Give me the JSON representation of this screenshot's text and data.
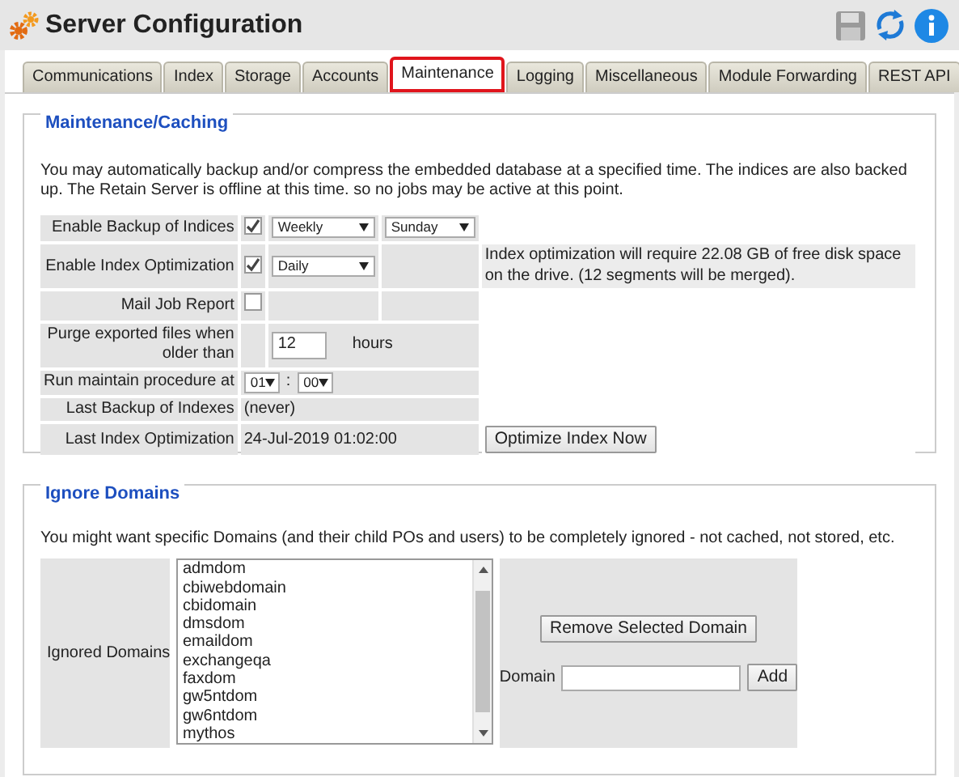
{
  "header": {
    "title": "Server Configuration"
  },
  "tabs": [
    {
      "label": "Communications",
      "selected": false
    },
    {
      "label": "Index",
      "selected": false
    },
    {
      "label": "Storage",
      "selected": false
    },
    {
      "label": "Accounts",
      "selected": false
    },
    {
      "label": "Maintenance",
      "selected": true
    },
    {
      "label": "Logging",
      "selected": false
    },
    {
      "label": "Miscellaneous",
      "selected": false
    },
    {
      "label": "Module Forwarding",
      "selected": false
    },
    {
      "label": "REST API",
      "selected": false
    }
  ],
  "maintenance": {
    "legend": "Maintenance/Caching",
    "intro": "You may automatically backup and/or compress the embedded database at a specified time. The indices are also backed up. The Retain Server is offline at this time. so no jobs may be active at this point.",
    "rows": [
      {
        "kind": "checkbox_selects",
        "label": "Enable Backup of Indices",
        "checked": true,
        "selects": [
          "Weekly",
          "Sunday"
        ]
      },
      {
        "kind": "checkbox_note",
        "label": "Enable Index Optimization",
        "checked": true,
        "selects": [
          "Daily"
        ],
        "note": "Index optimization will require 22.08 GB of free disk space on the drive. (12 segments will be merged)."
      },
      {
        "kind": "checkbox",
        "label": "Mail Job Report",
        "checked": false
      },
      {
        "kind": "input_unit",
        "label": "Purge exported files when older than",
        "value": "12",
        "unit": "hours"
      },
      {
        "kind": "time",
        "label": "Run maintain procedure at",
        "hour": "01",
        "separator": ":",
        "minute": "00"
      },
      {
        "kind": "info",
        "label": "Last Backup of Indexes",
        "value": "(never)"
      },
      {
        "kind": "info_button",
        "label": "Last Index Optimization",
        "value": "24-Jul-2019 01:02:00",
        "button": "Optimize Index Now"
      }
    ]
  },
  "ignore_domains": {
    "legend": "Ignore Domains",
    "intro": "You might want specific Domains (and their child POs and users) to be completely ignored - not cached, not stored, etc.",
    "label": "Ignored Domains",
    "domains": [
      "admdom",
      "cbiwebdomain",
      "cbidomain",
      "dmsdom",
      "emaildom",
      "exchangeqa",
      "faxdom",
      "gw5ntdom",
      "gw6ntdom",
      "mythos"
    ],
    "remove_button": "Remove Selected Domain",
    "domain_label": "Domain",
    "add_button": "Add"
  }
}
